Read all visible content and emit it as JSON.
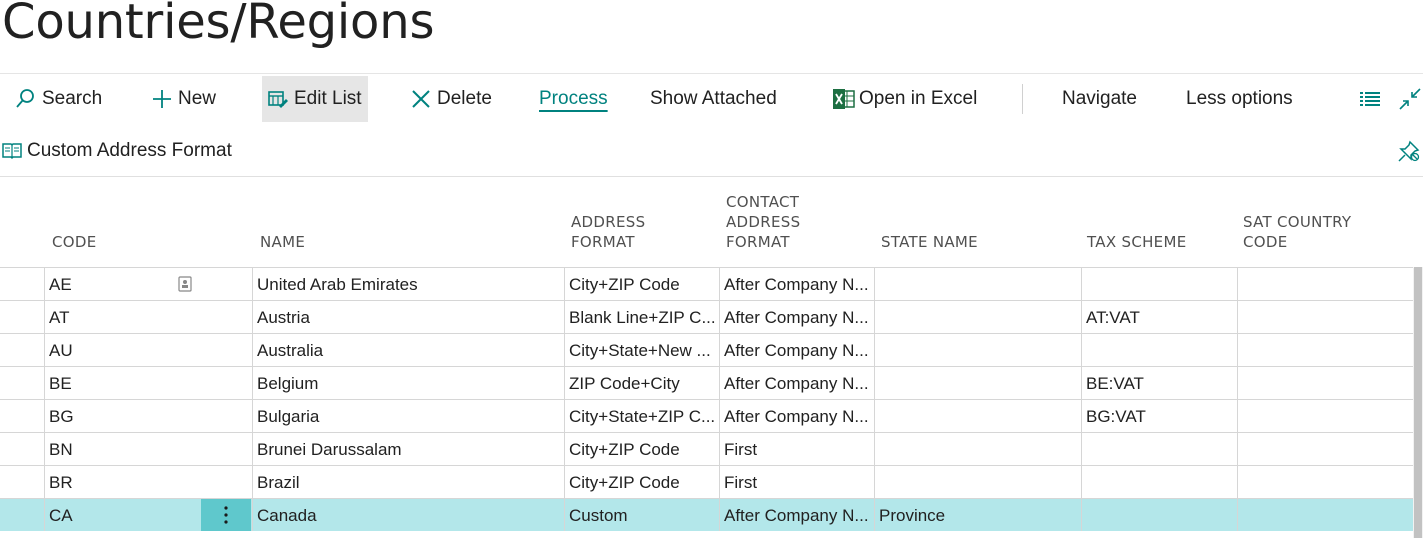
{
  "page": {
    "title": "Countries/Regions"
  },
  "actions": [
    {
      "label": "Search",
      "icon": "search-icon"
    },
    {
      "label": "New",
      "icon": "plus-icon"
    },
    {
      "label": "Edit List",
      "icon": "edit-list-icon"
    },
    {
      "label": "Delete",
      "icon": "delete-icon"
    },
    {
      "label": "Process",
      "icon": ""
    },
    {
      "label": "Show Attached",
      "icon": ""
    },
    {
      "label": "Open in Excel",
      "icon": "excel-icon"
    },
    {
      "label": "Navigate",
      "icon": ""
    },
    {
      "label": "Less options",
      "icon": ""
    }
  ],
  "subactions": {
    "custom_address_format": "Custom Address Format"
  },
  "colors": {
    "accent": "#00827f",
    "selected_row": "#b3e7ea",
    "selected_handle": "#5fc8cc"
  },
  "table": {
    "headers": {
      "code": "CODE",
      "name": "NAME",
      "address_format": "ADDRESS\nFORMAT",
      "contact_address_format": "CONTACT\nADDRESS\nFORMAT",
      "state_name": "STATE NAME",
      "tax_scheme": "TAX SCHEME",
      "sat_country_code": "SAT COUNTRY\nCODE"
    },
    "rows": [
      {
        "code": "AE",
        "name": "United Arab Emirates",
        "address_format": "City+ZIP Code",
        "contact_address_format": "After Company N...",
        "state_name": "",
        "tax_scheme": "",
        "sat_country_code": ""
      },
      {
        "code": "AT",
        "name": "Austria",
        "address_format": "Blank Line+ZIP C...",
        "contact_address_format": "After Company N...",
        "state_name": "",
        "tax_scheme": "AT:VAT",
        "sat_country_code": ""
      },
      {
        "code": "AU",
        "name": "Australia",
        "address_format": "City+State+New ...",
        "contact_address_format": "After Company N...",
        "state_name": "",
        "tax_scheme": "",
        "sat_country_code": ""
      },
      {
        "code": "BE",
        "name": "Belgium",
        "address_format": "ZIP Code+City",
        "contact_address_format": "After Company N...",
        "state_name": "",
        "tax_scheme": "BE:VAT",
        "sat_country_code": ""
      },
      {
        "code": "BG",
        "name": "Bulgaria",
        "address_format": "City+State+ZIP C...",
        "contact_address_format": "After Company N...",
        "state_name": "",
        "tax_scheme": "BG:VAT",
        "sat_country_code": ""
      },
      {
        "code": "BN",
        "name": "Brunei Darussalam",
        "address_format": "City+ZIP Code",
        "contact_address_format": "First",
        "state_name": "",
        "tax_scheme": "",
        "sat_country_code": ""
      },
      {
        "code": "BR",
        "name": "Brazil",
        "address_format": "City+ZIP Code",
        "contact_address_format": "First",
        "state_name": "",
        "tax_scheme": "",
        "sat_country_code": ""
      },
      {
        "code": "CA",
        "name": "Canada",
        "address_format": "Custom",
        "contact_address_format": "After Company N...",
        "state_name": "Province",
        "tax_scheme": "",
        "sat_country_code": ""
      }
    ]
  }
}
